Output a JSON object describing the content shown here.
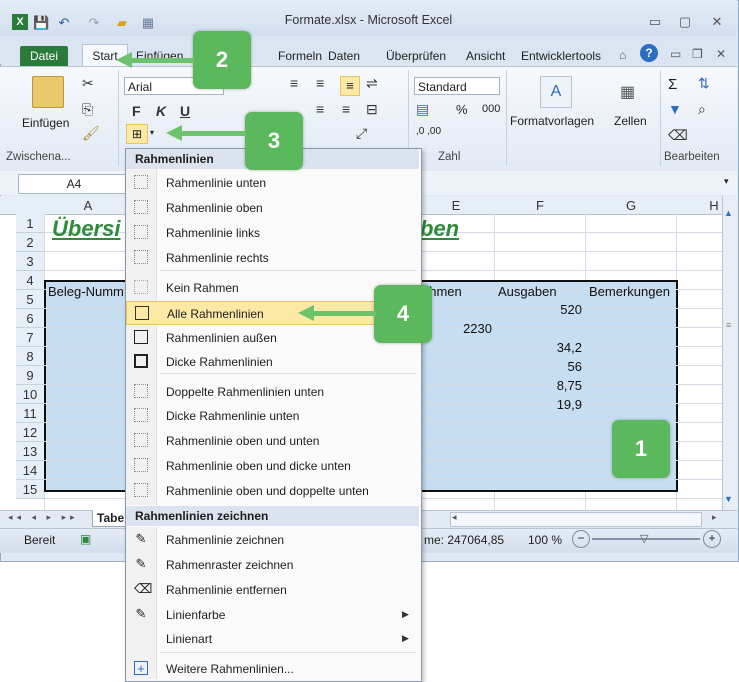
{
  "window": {
    "title": "Formate.xlsx  -  Microsoft Excel"
  },
  "tabs": [
    {
      "label": "Datei"
    },
    {
      "label": "Start"
    },
    {
      "label": "Einfügen"
    },
    {
      "label": "Formeln"
    },
    {
      "label": "Daten"
    },
    {
      "label": "Überprüfen"
    },
    {
      "label": "Ansicht"
    },
    {
      "label": "Entwicklertools"
    }
  ],
  "ribbon": {
    "paste_label": "Einfügen",
    "clipboard_group": "Zwischena...",
    "font_name": "Arial",
    "bold": "F",
    "italic": "K",
    "underline": "U",
    "number_format": "Standard",
    "percent": "%",
    "thousands": "000",
    "decimal_increase": ",0 ,00",
    "number_group": "Zahl",
    "styles_label": "Formatvorlagen",
    "cells_label": "Zellen",
    "editing_group": "Bearbeiten",
    "sigma": "Σ"
  },
  "formula_bar": {
    "name_box": "A4"
  },
  "columns": [
    "A",
    "E",
    "F",
    "G",
    "H"
  ],
  "rows": [
    "1",
    "2",
    "3",
    "4",
    "5",
    "6",
    "7",
    "8",
    "9",
    "10",
    "11",
    "12",
    "13",
    "14",
    "15"
  ],
  "cells": {
    "a1": "Übersi",
    "e1": "ben",
    "a4": "Beleg-Numm",
    "e4": "ahmen",
    "f4": "Ausgaben",
    "g4": "Bemerkungen",
    "f5": "520",
    "e6": "2230",
    "f7": "34,2",
    "f8": "56",
    "f9": "8,75",
    "f10": "19,9"
  },
  "sheet_tab": "Tabe",
  "status": {
    "ready": "Bereit",
    "sum": "me: 247064,85",
    "zoom": "100 %"
  },
  "menu": {
    "section1": "Rahmenlinien",
    "items1": [
      "Rahmenlinie unten",
      "Rahmenlinie oben",
      "Rahmenlinie links",
      "Rahmenlinie rechts",
      "Kein Rahmen",
      "Alle Rahmenlinien",
      "Rahmenlinien außen",
      "Dicke Rahmenlinien",
      "Doppelte Rahmenlinien unten",
      "Dicke Rahmenlinie unten",
      "Rahmenlinie oben und unten",
      "Rahmenlinie oben und dicke unten",
      "Rahmenlinie oben und doppelte unten"
    ],
    "section2": "Rahmenlinien zeichnen",
    "items2": [
      "Rahmenlinie zeichnen",
      "Rahmenraster zeichnen",
      "Rahmenlinie entfernen",
      "Linienfarbe",
      "Linienart",
      "Weitere Rahmenlinien..."
    ]
  },
  "callouts": [
    "1",
    "2",
    "3",
    "4"
  ],
  "colors": {
    "callout": "#5cb85c",
    "selection": "#c7ddf1",
    "menu_highlight": "#fde9a6",
    "heading": "#2e8b3a"
  }
}
